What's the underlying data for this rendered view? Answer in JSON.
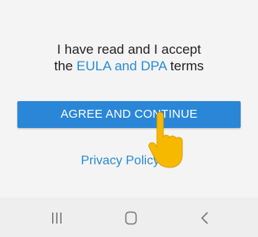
{
  "consent": {
    "line1": "I have read and I accept",
    "line2_prefix": "the ",
    "line2_link": "EULA and DPA",
    "line2_suffix": " terms"
  },
  "agree_button": {
    "label": "AGREE AND CONTINUE"
  },
  "privacy": {
    "label": "Privacy Policy",
    "icon": "external-link-icon"
  },
  "nav_bar": {
    "recent_icon": "recent-apps-icon",
    "home_icon": "home-icon",
    "back_icon": "back-icon"
  },
  "colors": {
    "accent": "#2a87d8",
    "link": "#2a8bd6",
    "background": "#f4f4f4",
    "nav_background": "#eeeeee",
    "hand": "#f6b900"
  }
}
